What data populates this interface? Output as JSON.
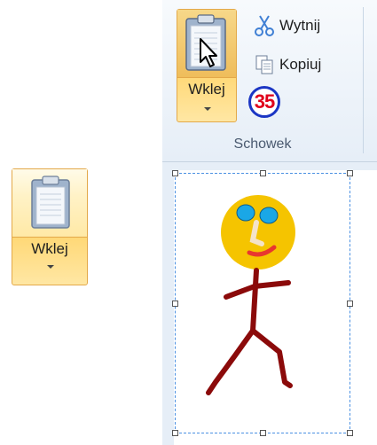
{
  "left_paste_button": {
    "label": "Wklej"
  },
  "ribbon": {
    "paste_label": "Wklej",
    "cut_label": "Wytnij",
    "copy_label": "Kopiuj",
    "group_label": "Schowek",
    "badge_number": "35"
  },
  "icons": {
    "clipboard": "clipboard-icon",
    "scissors": "scissors-icon",
    "copy": "copy-icon",
    "cursor": "mouse-pointer-icon",
    "dropdown": "chevron-down-icon"
  },
  "colors": {
    "hover_border": "#e3a94a",
    "badge_ring": "#1b36c4",
    "badge_text": "#e0001b",
    "selection_dash": "#4a90e2",
    "face": "#f5c400",
    "eyes": "#1aa7e6",
    "mouth": "#e8362f",
    "body": "#8b0a0a"
  }
}
